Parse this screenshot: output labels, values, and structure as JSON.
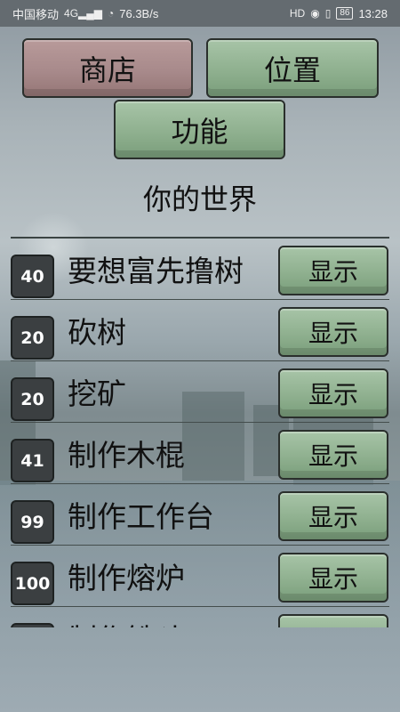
{
  "status_bar": {
    "carrier": "中国移动",
    "network": "4G",
    "speed": "76.3B/s",
    "battery": "86",
    "time": "13:28",
    "icons": [
      "signal-icon",
      "wifi-icon",
      "hd-icon",
      "eye-icon",
      "vibrate-icon",
      "battery-icon"
    ]
  },
  "nav": {
    "shop": "商店",
    "position": "位置",
    "function": "功能"
  },
  "section_title": "你的世界",
  "tasks": [
    {
      "level": "40",
      "name": "要想富先撸树",
      "button": "显示"
    },
    {
      "level": "20",
      "name": "砍树",
      "button": "显示"
    },
    {
      "level": "20",
      "name": "挖矿",
      "button": "显示"
    },
    {
      "level": "41",
      "name": "制作木棍",
      "button": "显示"
    },
    {
      "level": "99",
      "name": "制作工作台",
      "button": "显示"
    },
    {
      "level": "100",
      "name": "制作熔炉",
      "button": "显示"
    },
    {
      "level": "",
      "name": "制作铁斗",
      "button": "显示"
    }
  ],
  "colors": {
    "shop_button": "#a88a8b",
    "green_button": "#8fb08f",
    "level_badge": "#3b3f41",
    "status_bar": "#646b70"
  }
}
